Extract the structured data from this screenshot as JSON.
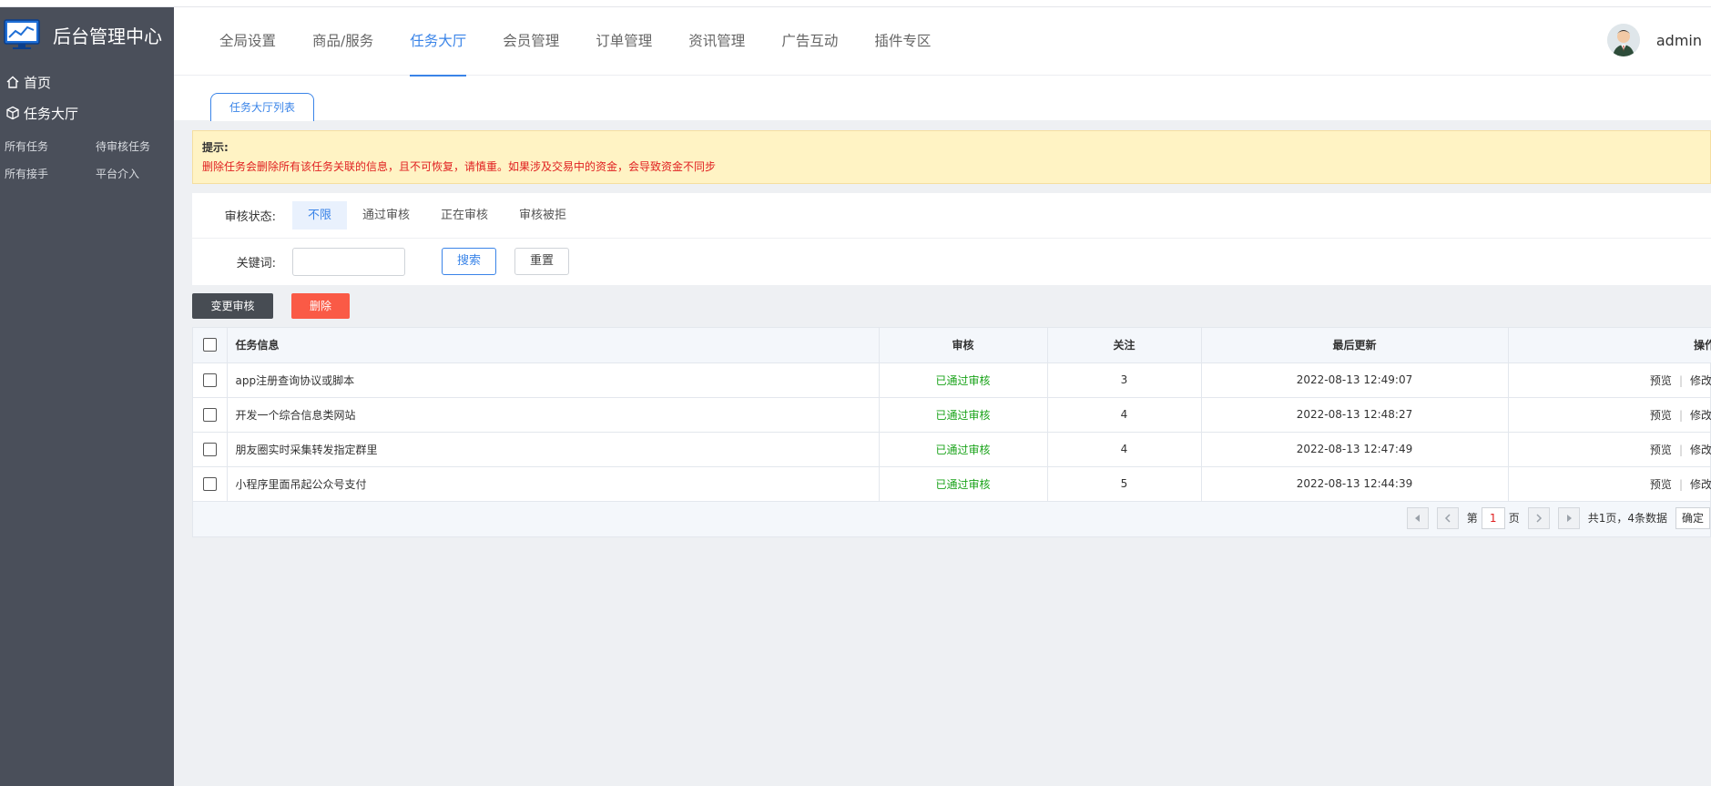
{
  "app": {
    "title": "后台管理中心"
  },
  "sidebar": {
    "menus": [
      {
        "label": "首页",
        "icon": "home-icon"
      },
      {
        "label": "任务大厅",
        "icon": "cube-icon"
      }
    ],
    "subitems": [
      "所有任务",
      "待审核任务",
      "所有接手",
      "平台介入"
    ]
  },
  "topnav": {
    "items": [
      "全局设置",
      "商品/服务",
      "任务大厅",
      "会员管理",
      "订单管理",
      "资讯管理",
      "广告互动",
      "插件专区"
    ],
    "active": "任务大厅"
  },
  "user": {
    "name": "admin"
  },
  "tab": {
    "label": "任务大厅列表"
  },
  "notice": {
    "title": "提示:",
    "message": "删除任务会删除所有该任务关联的信息，且不可恢复，请慎重。如果涉及交易中的资金，会导致资金不同步"
  },
  "filter": {
    "status_label": "审核状态:",
    "status_options": [
      "不限",
      "通过审核",
      "正在审核",
      "审核被拒"
    ],
    "status_selected": "不限",
    "keyword_label": "关键词:",
    "keyword_value": "",
    "search_label": "搜索",
    "reset_label": "重置"
  },
  "actions": {
    "change_audit": "变更审核",
    "delete": "删除"
  },
  "table": {
    "columns": [
      "任务信息",
      "审核",
      "关注",
      "最后更新",
      "操作"
    ],
    "rows": [
      {
        "info": "app注册查询协议或脚本",
        "audit": "已通过审核",
        "follow": "3",
        "updated": "2022-08-13 12:49:07"
      },
      {
        "info": "开发一个综合信息类网站",
        "audit": "已通过审核",
        "follow": "4",
        "updated": "2022-08-13 12:48:27"
      },
      {
        "info": "朋友圈实时采集转发指定群里",
        "audit": "已通过审核",
        "follow": "4",
        "updated": "2022-08-13 12:47:49"
      },
      {
        "info": "小程序里面吊起公众号支付",
        "audit": "已通过审核",
        "follow": "5",
        "updated": "2022-08-13 12:44:39"
      }
    ],
    "op_preview": "预览",
    "op_sep": "|",
    "op_edit": "修改"
  },
  "pager": {
    "page_prefix": "第",
    "page": "1",
    "page_suffix": "页",
    "summary": "共1页，4条数据",
    "confirm": "确定"
  },
  "colors": {
    "accent": "#3a84e8",
    "sidebar": "#4a4f5a",
    "danger": "#fa5a46",
    "success": "#1aa31a"
  }
}
